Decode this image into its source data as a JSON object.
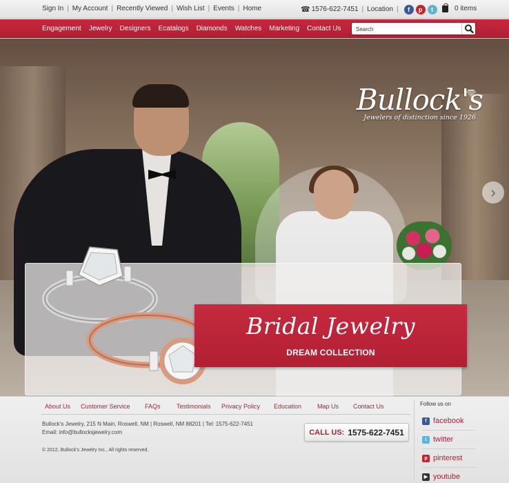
{
  "top_links": [
    "Sign In",
    "My Account",
    "Recently Viewed",
    "Wish List",
    "Events",
    "Home"
  ],
  "phone": "1576-622-7451",
  "location": "Location",
  "cart": "0 items",
  "nav": [
    "Engagement",
    "Jewelry",
    "Designers",
    "Ecatalogs",
    "Diamonds",
    "Watches",
    "Marketing",
    "Contact Us"
  ],
  "search": {
    "placeholder": "Search"
  },
  "logo": {
    "brand": "Bullock's",
    "tagline": "Jewelers of distinction since 1926"
  },
  "banner": {
    "title": "Bridal Jewelry",
    "subtitle": "DREAM COLLECTION"
  },
  "footer": {
    "links": [
      "About Us",
      "Customer Service",
      "FAQs",
      "Testimonials",
      "Privacy Policy",
      "Education",
      "Map Us",
      "Contact Us"
    ],
    "address": "Bullock's Jewelry, 215 N Main, Roswell, NM  |  Roswell, NM 88201  |  Tel: 1575-622-7451",
    "email": "Email: info@bullocksjewelry.com",
    "copyright": "© 2012, Bullock's Jewelry Inc., All rights reserved.",
    "call_label": "CALL US:",
    "call_number": "1575-622-7451",
    "follow": "Follow us on",
    "social": [
      "facebook",
      "twitter",
      "pinterest",
      "youtube"
    ]
  },
  "colors": {
    "brand_red": "#b11f33",
    "facebook": "#3b5998",
    "twitter": "#5fb4d6",
    "pinterest": "#c8232c",
    "youtube": "#333333"
  }
}
